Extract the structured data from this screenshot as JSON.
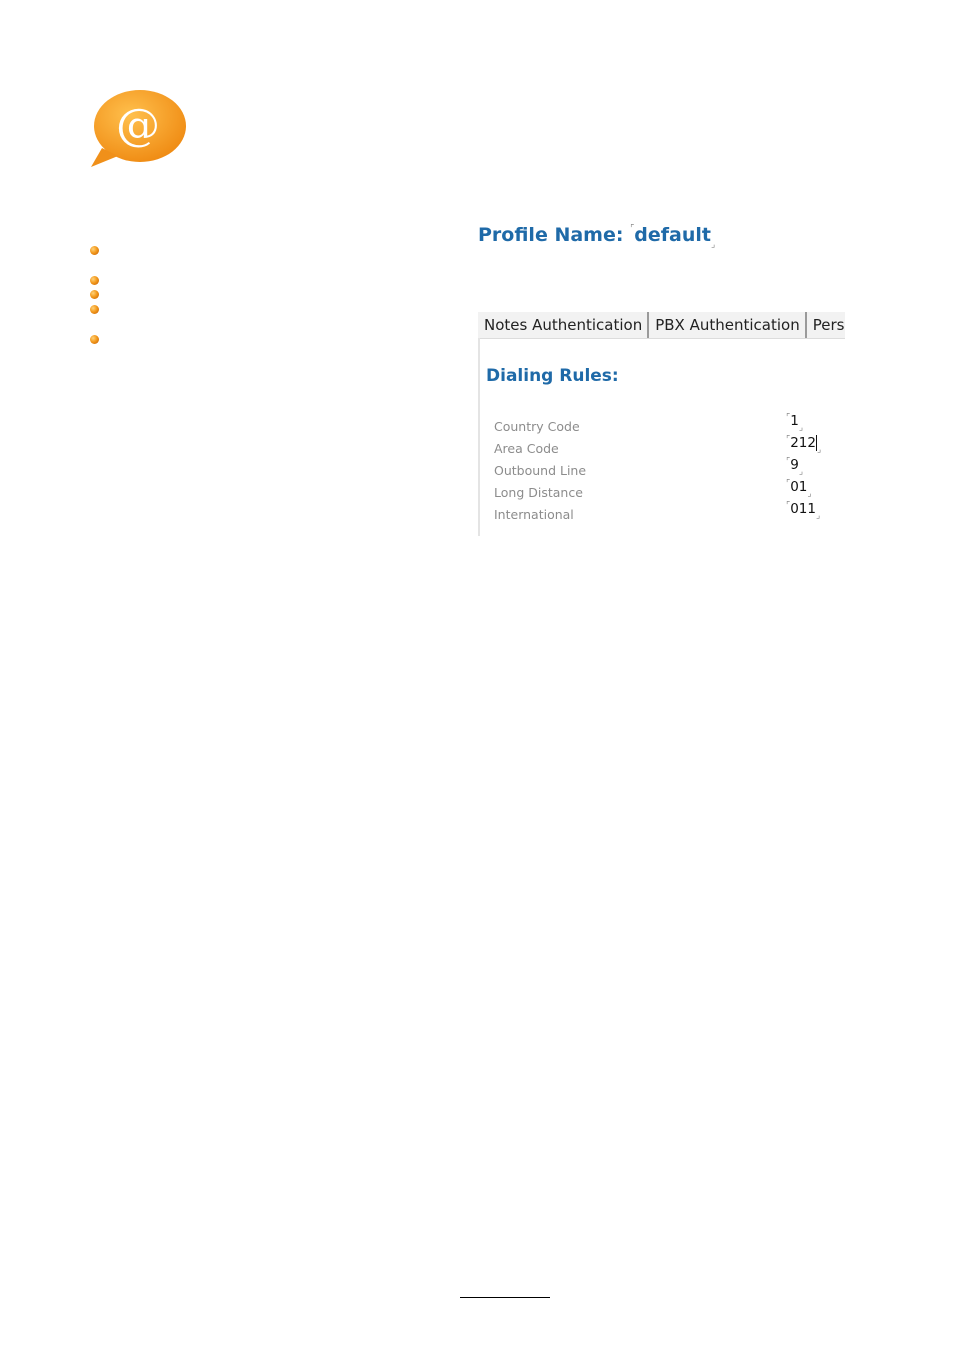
{
  "profile": {
    "label": "Profile Name:",
    "value": "default"
  },
  "tabs": [
    "Notes Authentication",
    "PBX Authentication",
    "Person"
  ],
  "dialing_rules": {
    "title": "Dialing Rules:",
    "rows": [
      {
        "label": "Country Code",
        "value": "1"
      },
      {
        "label": "Area Code",
        "value": "212"
      },
      {
        "label": "Outbound Line",
        "value": "9"
      },
      {
        "label": "Long Distance",
        "value": "01"
      },
      {
        "label": "International",
        "value": "011"
      }
    ]
  },
  "logo": {
    "glyph": "@",
    "color": "#f39a1d",
    "icon": "email-chat-bubble-icon"
  },
  "bullet_color": "#f08c1a",
  "accent_color": "#1f6aa8"
}
